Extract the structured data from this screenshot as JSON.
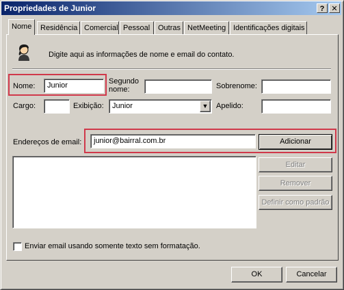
{
  "window": {
    "title": "Propriedades de Junior",
    "help_btn": "?",
    "close_btn": "✕"
  },
  "tabs": [
    {
      "label": "Nome"
    },
    {
      "label": "Residência"
    },
    {
      "label": "Comercial"
    },
    {
      "label": "Pessoal"
    },
    {
      "label": "Outras"
    },
    {
      "label": "NetMeeting"
    },
    {
      "label": "Identificações digitais"
    }
  ],
  "header": {
    "hint": "Digite aqui as informações de nome e email do contato."
  },
  "form": {
    "nome_label": "Nome:",
    "nome_value": "Junior",
    "segundo_label_1": "Segundo",
    "segundo_label_2": "nome:",
    "segundo_value": "",
    "sobrenome_label": "Sobrenome:",
    "sobrenome_value": "",
    "cargo_label": "Cargo:",
    "cargo_value": "",
    "exibicao_label": "Exibição:",
    "exibicao_value": "Junior",
    "apelido_label": "Apelido:",
    "apelido_value": ""
  },
  "email": {
    "label": "Endereços de email:",
    "value": "junior@bairral.com.br",
    "add_btn": "Adicionar",
    "edit_btn": "Editar",
    "remove_btn": "Remover",
    "default_btn": "Definir como padrão",
    "list": []
  },
  "plaintext_checkbox": {
    "label": "Enviar email usando somente texto sem formatação.",
    "checked": false
  },
  "footer": {
    "ok": "OK",
    "cancel": "Cancelar"
  }
}
